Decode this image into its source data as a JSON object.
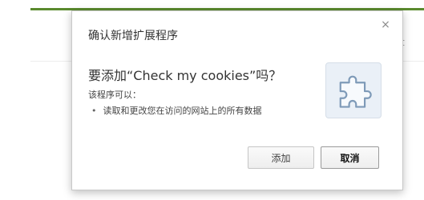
{
  "colors": {
    "accent": "#5a8a2e"
  },
  "background": {
    "partial_text": "t"
  },
  "dialog": {
    "title": "确认新增扩展程序",
    "close_glyph": "×",
    "question": "要添加“Check my cookies”吗？",
    "permissions_heading": "该程序可以：",
    "permissions": [
      "读取和更改您在访问的网站上的所有数据"
    ],
    "icon": "puzzle-piece-icon",
    "buttons": {
      "add": "添加",
      "cancel": "取消"
    }
  }
}
